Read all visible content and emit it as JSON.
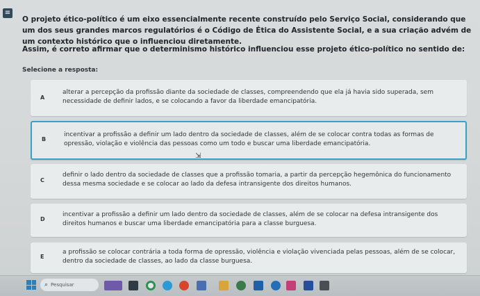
{
  "header": {
    "menu_icon": "menu-icon",
    "question": "O projeto ético-político é um eixo essencialmente recente construído pelo Serviço Social, considerando que um dos seus grandes marcos regulatórios é o Código de Ética do Assistente Social, e a sua criação advém de um contexto histórico que o influenciou diretamente.",
    "prompt": "Assim, é correto afirmar que o determinismo histórico influenciou esse projeto ético-político no sentido de:",
    "select_label": "Selecione a resposta:"
  },
  "options": [
    {
      "letter": "A",
      "text": "alterar a percepção da profissão diante da sociedade de classes, compreendendo que ela já havia sido superada, sem necessidade de definir lados, e se colocando a favor da liberdade emancipatória."
    },
    {
      "letter": "B",
      "text": "incentivar a profissão a definir um lado dentro da sociedade de classes, além de se colocar contra todas as formas de opressão, violação e violência das pessoas como um todo e buscar uma liberdade emancipatória."
    },
    {
      "letter": "C",
      "text": "definir o lado dentro da sociedade de classes que a profissão tomaria, a partir da percepção hegemônica do funcionamento dessa mesma sociedade e se colocar ao lado da defesa intransigente dos direitos humanos."
    },
    {
      "letter": "D",
      "text": "incentivar a profissão a definir um lado dentro da sociedade de classes, além de se colocar na defesa intransigente dos direitos humanos e buscar uma liberdade emancipatória para a classe burguesa."
    },
    {
      "letter": "E",
      "text": "a profissão se colocar contrária a toda forma de opressão, violência e violação vivenciada pelas pessoas, além de se colocar, dentro da sociedade de classes, ao lado da classe burguesa."
    }
  ],
  "selected_letter": "B",
  "taskbar": {
    "search_placeholder": "Pesquisar",
    "icons": [
      "windows-start-icon",
      "search-icon",
      "widget-icon",
      "task-view-icon",
      "chrome-icon",
      "edge-icon",
      "file-explorer-icon",
      "store-icon",
      "mail-icon",
      "photos-icon",
      "word-icon",
      "app-icon"
    ],
    "colors": {
      "accent": "#3aa0c8",
      "background": "#d6d9d9"
    }
  }
}
